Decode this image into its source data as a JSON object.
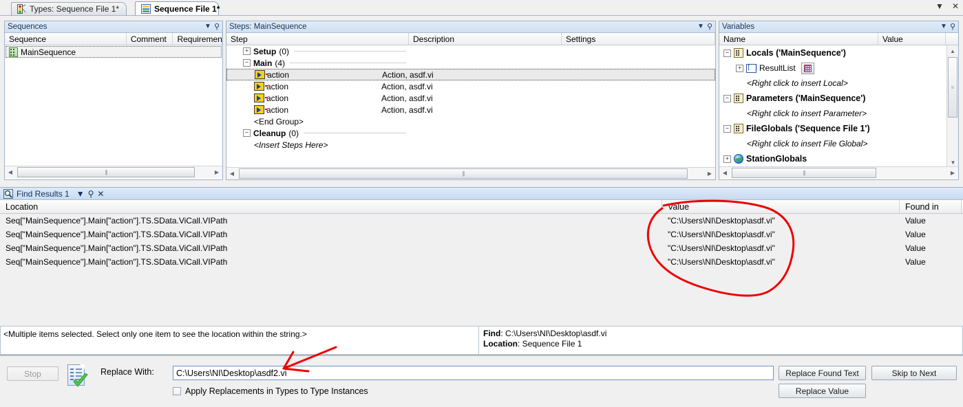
{
  "window": {
    "tabs": [
      {
        "label": "Types: Sequence File 1*",
        "icon": "types-icon",
        "active": false
      },
      {
        "label": "Sequence File 1*",
        "icon": "sequence-file-icon",
        "active": true
      }
    ],
    "controls": {
      "dropdown": "▼",
      "close": "✕"
    }
  },
  "sequences_panel": {
    "title": "Sequences",
    "columns": [
      "Sequence",
      "Comment",
      "Requiremen"
    ],
    "rows": [
      {
        "sequence": "MainSequence",
        "comment": "",
        "requirement": ""
      }
    ]
  },
  "steps_panel": {
    "title": "Steps: MainSequence",
    "columns": [
      "Step",
      "Description",
      "Settings"
    ],
    "rows": [
      {
        "kind": "group",
        "label": "Setup",
        "count": "(0)",
        "expanded": false,
        "description": "",
        "settings": ""
      },
      {
        "kind": "group",
        "label": "Main",
        "count": "(4)",
        "expanded": true,
        "description": "",
        "settings": ""
      },
      {
        "kind": "step",
        "label": "action",
        "description": "Action,  asdf.vi",
        "settings": "",
        "selected": true
      },
      {
        "kind": "step",
        "label": "action",
        "description": "Action,  asdf.vi",
        "settings": "",
        "selected": false
      },
      {
        "kind": "step",
        "label": "action",
        "description": "Action,  asdf.vi",
        "settings": "",
        "selected": false
      },
      {
        "kind": "step",
        "label": "action",
        "description": "Action,  asdf.vi",
        "settings": "",
        "selected": false
      },
      {
        "kind": "marker",
        "label": "<End Group>",
        "description": "",
        "settings": ""
      },
      {
        "kind": "group",
        "label": "Cleanup",
        "count": "(0)",
        "expanded": true,
        "description": "",
        "settings": ""
      },
      {
        "kind": "placeholder",
        "label": "<Insert Steps Here>",
        "description": "",
        "settings": ""
      }
    ]
  },
  "variables_panel": {
    "title": "Variables",
    "columns": [
      "Name",
      "Value"
    ],
    "rows": [
      {
        "kind": "root",
        "label": "Locals ('MainSequence')",
        "expander": "−",
        "icon": "locals-icon",
        "indent": 0
      },
      {
        "kind": "item",
        "label": "ResultList",
        "expander": "+",
        "icon": "array-icon",
        "indent": 1,
        "button": "array-view-button"
      },
      {
        "kind": "hint",
        "label": "<Right click to insert Local>",
        "indent": 1
      },
      {
        "kind": "root",
        "label": "Parameters ('MainSequence')",
        "expander": "−",
        "icon": "parameters-icon",
        "indent": 0
      },
      {
        "kind": "hint",
        "label": "<Right click to insert Parameter>",
        "indent": 1
      },
      {
        "kind": "root",
        "label": "FileGlobals ('Sequence File 1')",
        "expander": "−",
        "icon": "fileglobals-icon",
        "indent": 0
      },
      {
        "kind": "hint",
        "label": "<Right click to insert File Global>",
        "indent": 1
      },
      {
        "kind": "root",
        "label": "StationGlobals",
        "expander": "+",
        "icon": "globe-icon",
        "indent": 0
      }
    ]
  },
  "find_results": {
    "title": "Find Results 1",
    "columns": [
      "Location",
      "Value",
      "Found in"
    ],
    "rows": [
      {
        "location": "Seq[\"MainSequence\"].Main[\"action\"].TS.SData.ViCall.VIPath",
        "value": "\"C:\\Users\\NI\\Desktop\\asdf.vi\"",
        "found_in": "Value"
      },
      {
        "location": "Seq[\"MainSequence\"].Main[\"action\"].TS.SData.ViCall.VIPath",
        "value": "\"C:\\Users\\NI\\Desktop\\asdf.vi\"",
        "found_in": "Value"
      },
      {
        "location": "Seq[\"MainSequence\"].Main[\"action\"].TS.SData.ViCall.VIPath",
        "value": "\"C:\\Users\\NI\\Desktop\\asdf.vi\"",
        "found_in": "Value"
      },
      {
        "location": "Seq[\"MainSequence\"].Main[\"action\"].TS.SData.ViCall.VIPath",
        "value": "\"C:\\Users\\NI\\Desktop\\asdf.vi\"",
        "found_in": "Value"
      }
    ],
    "status_message": "<Multiple items selected. Select only one item to see the location within the string.>",
    "detail": {
      "find_label": "Find",
      "find_value": "C:\\Users\\NI\\Desktop\\asdf.vi",
      "location_label": "Location",
      "location_value": "Sequence File 1"
    }
  },
  "toolbar": {
    "stop_label": "Stop",
    "replace_with_label": "Replace With:",
    "replace_with_value": "C:\\Users\\NI\\Desktop\\asdf2.vi",
    "apply_checkbox_label": "Apply Replacements in Types to Type Instances",
    "apply_checked": false,
    "replace_found_text_label": "Replace Found Text",
    "replace_value_label": "Replace Value",
    "skip_to_next_label": "Skip to Next"
  },
  "annotations": {
    "color": "#ee0000",
    "ellipse_target": "find-results-value-column",
    "arrow_target": "replace-with-input"
  }
}
